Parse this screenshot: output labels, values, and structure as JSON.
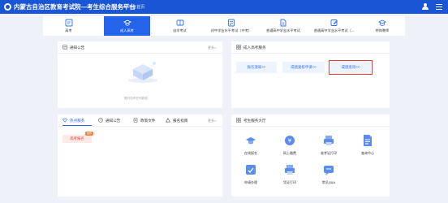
{
  "header": {
    "title": "内蒙古自治区教育考试院—考生综合服务平台",
    "home_label": "平台首页",
    "brand_color": "#1a55d6"
  },
  "nav": {
    "items": [
      {
        "label": "高考",
        "icon": "cap-icon"
      },
      {
        "label": "成人高考",
        "icon": "graduate-icon",
        "active": true
      },
      {
        "label": "自学考试",
        "icon": "book-icon"
      },
      {
        "label": "初中学业水平考试（中考）",
        "icon": "exam-icon"
      },
      {
        "label": "普通高中学业水平考试",
        "icon": "document-icon"
      },
      {
        "label": "普通高中学业水平考试（...",
        "icon": "edit-icon"
      },
      {
        "label": "特岗教师",
        "icon": "teacher-icon"
      }
    ]
  },
  "notice": {
    "title": "通知公告",
    "more": "更多>",
    "empty_text": "暂时没有任何数据"
  },
  "hot": {
    "tabs": [
      "热点服务",
      "通知公告",
      "政策文件",
      "报名指南"
    ],
    "more": "更多>",
    "chip": {
      "label": "高考报名",
      "tag": "推荐"
    }
  },
  "adult": {
    "title": "成人高考服务",
    "buttons": [
      "报名须知>>",
      "成绩复核申请>>",
      "成绩查询>>"
    ],
    "highlight_color": "#e03a32"
  },
  "hall": {
    "title": "考生服务大厅",
    "items": [
      {
        "label": "在线报名",
        "icon": "graduation-icon",
        "color": "#5b8def"
      },
      {
        "label": "网上缴费",
        "icon": "payment-icon",
        "color": "#5b8def"
      },
      {
        "label": "准考证打印",
        "icon": "print-icon",
        "color": "#5b8def"
      },
      {
        "label": "查询中心",
        "icon": "file-search-icon",
        "color": "#5b8def"
      },
      {
        "label": "申请办理",
        "icon": "apply-icon",
        "color": "#5b8def"
      },
      {
        "label": "凭证打印",
        "icon": "receipt-icon",
        "color": "#5b8def"
      },
      {
        "label": "常见Q&A",
        "icon": "qa-icon",
        "color": "#5b8def"
      }
    ]
  }
}
